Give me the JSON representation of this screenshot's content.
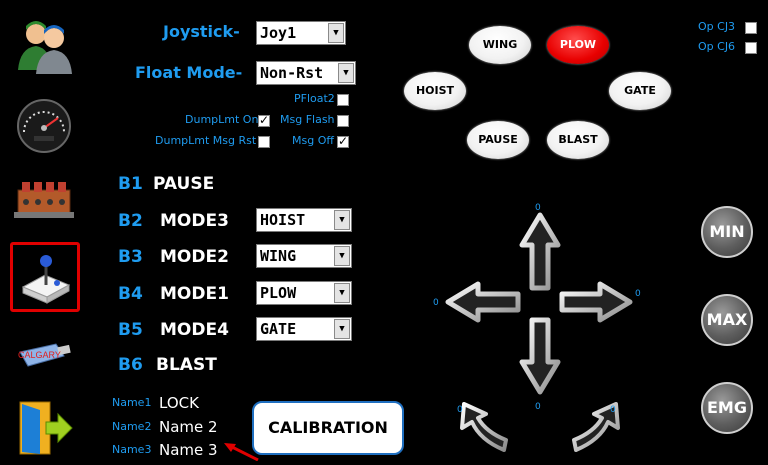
{
  "top": {
    "joystick_label": "Joystick-",
    "joystick_value": "Joy1",
    "float_mode_label": "Float Mode-",
    "float_mode_value": "Non-Rst"
  },
  "options": {
    "pfloat2": "PFloat2",
    "dumplmt_on": "DumpLmt On",
    "msg_flash": "Msg Flash",
    "dumplmt_msg_rst": "DumpLmt Msg Rst",
    "msg_off": "Msg Off",
    "op_cj3": "Op CJ3",
    "op_cj6": "Op CJ6"
  },
  "buttons": [
    {
      "num": "B1",
      "name": "PAUSE",
      "mode": ""
    },
    {
      "num": "B2",
      "name": "MODE3",
      "mode": "HOIST"
    },
    {
      "num": "B3",
      "name": "MODE2",
      "mode": "WING"
    },
    {
      "num": "B4",
      "name": "MODE1",
      "mode": "PLOW"
    },
    {
      "num": "B5",
      "name": "MODE4",
      "mode": "GATE"
    },
    {
      "num": "B6",
      "name": "BLAST",
      "mode": ""
    }
  ],
  "names": [
    {
      "label": "Name1",
      "value": "LOCK"
    },
    {
      "label": "Name2",
      "value": "Name 2"
    },
    {
      "label": "Name3",
      "value": "Name 3"
    }
  ],
  "calibration_label": "CALIBRATION",
  "function_buttons": {
    "wing": "WING",
    "plow": "PLOW",
    "hoist": "HOIST",
    "gate": "GATE",
    "pause": "PAUSE",
    "blast": "BLAST"
  },
  "side_buttons": {
    "min": "MIN",
    "max": "MAX",
    "emg": "EMG"
  },
  "sidebar": {
    "calgary_label": "CALGARY"
  },
  "joystick_readouts": {
    "up": "0",
    "left": "0",
    "right": "0",
    "down": "0",
    "curve_left": "0",
    "curve_right": "0"
  },
  "colors": {
    "accent": "#1f9cf0",
    "plow_active": "#e80000",
    "selection_border": "#e00000"
  }
}
